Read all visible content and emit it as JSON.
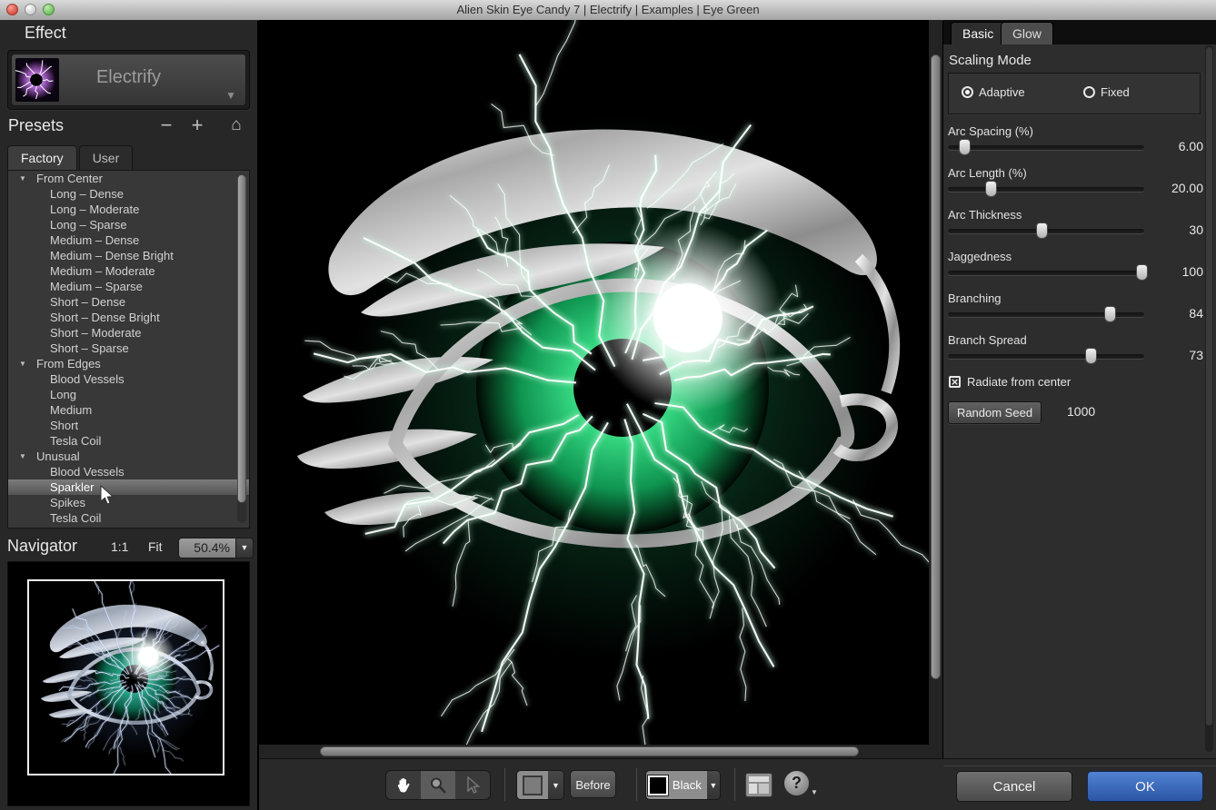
{
  "window": {
    "title": "Alien Skin Eye Candy 7 | Electrify | Examples | Eye Green"
  },
  "icons": {
    "dropdown": "▼",
    "group_expanded": "▼",
    "remove_preset": "−",
    "add_preset": "+",
    "home": "⌂",
    "help": "?",
    "checkbox_checked": "×"
  },
  "effect": {
    "section_title": "Effect",
    "name": "Electrify"
  },
  "presets": {
    "section_title": "Presets",
    "tabs": [
      {
        "label": "Factory",
        "active": true
      },
      {
        "label": "User",
        "active": false
      }
    ],
    "tree": [
      {
        "type": "group",
        "label": "From Center"
      },
      {
        "type": "item",
        "label": "Long – Dense"
      },
      {
        "type": "item",
        "label": "Long – Moderate"
      },
      {
        "type": "item",
        "label": "Long – Sparse"
      },
      {
        "type": "item",
        "label": "Medium – Dense"
      },
      {
        "type": "item",
        "label": "Medium – Dense Bright"
      },
      {
        "type": "item",
        "label": "Medium – Moderate"
      },
      {
        "type": "item",
        "label": "Medium – Sparse"
      },
      {
        "type": "item",
        "label": "Short – Dense"
      },
      {
        "type": "item",
        "label": "Short – Dense Bright"
      },
      {
        "type": "item",
        "label": "Short – Moderate"
      },
      {
        "type": "item",
        "label": "Short – Sparse"
      },
      {
        "type": "group",
        "label": "From Edges"
      },
      {
        "type": "item",
        "label": "Blood Vessels"
      },
      {
        "type": "item",
        "label": "Long"
      },
      {
        "type": "item",
        "label": "Medium"
      },
      {
        "type": "item",
        "label": "Short"
      },
      {
        "type": "item",
        "label": "Tesla Coil"
      },
      {
        "type": "group",
        "label": "Unusual"
      },
      {
        "type": "item",
        "label": "Blood Vessels"
      },
      {
        "type": "item",
        "label": "Sparkler",
        "selected": true
      },
      {
        "type": "item",
        "label": "Spikes"
      },
      {
        "type": "item",
        "label": "Tesla Coil"
      }
    ]
  },
  "navigator": {
    "section_title": "Navigator",
    "actual_size_label": "1:1",
    "fit_label": "Fit",
    "zoom_value": "50.4%"
  },
  "panel": {
    "tabs": [
      {
        "label": "Basic",
        "active": true
      },
      {
        "label": "Glow",
        "active": false
      }
    ],
    "scaling": {
      "title": "Scaling Mode",
      "options": [
        {
          "label": "Adaptive",
          "selected": true
        },
        {
          "label": "Fixed",
          "selected": false
        }
      ]
    },
    "sliders": [
      {
        "label": "Arc Spacing (%)",
        "value": "6.00",
        "percent": 9
      },
      {
        "label": "Arc Length (%)",
        "value": "20.00",
        "percent": 22
      },
      {
        "label": "Arc Thickness",
        "value": "30",
        "percent": 48
      },
      {
        "label": "Jaggedness",
        "value": "100",
        "percent": 99
      },
      {
        "label": "Branching",
        "value": "84",
        "percent": 83
      },
      {
        "label": "Branch Spread",
        "value": "73",
        "percent": 73
      }
    ],
    "radiate": {
      "label": "Radiate from center",
      "checked": true
    },
    "random_seed": {
      "button_label": "Random Seed",
      "value": "1000"
    }
  },
  "toolbar": {
    "before_label": "Before",
    "background_color": {
      "label": "Black",
      "hex": "#000000"
    }
  },
  "footer": {
    "cancel_label": "Cancel",
    "ok_label": "OK"
  },
  "colors": {
    "ok_blue": "#3e6cc0",
    "iris_green": "#27cf7a",
    "effect_purple": "#a45fc4",
    "lightning": "#ffffff"
  }
}
